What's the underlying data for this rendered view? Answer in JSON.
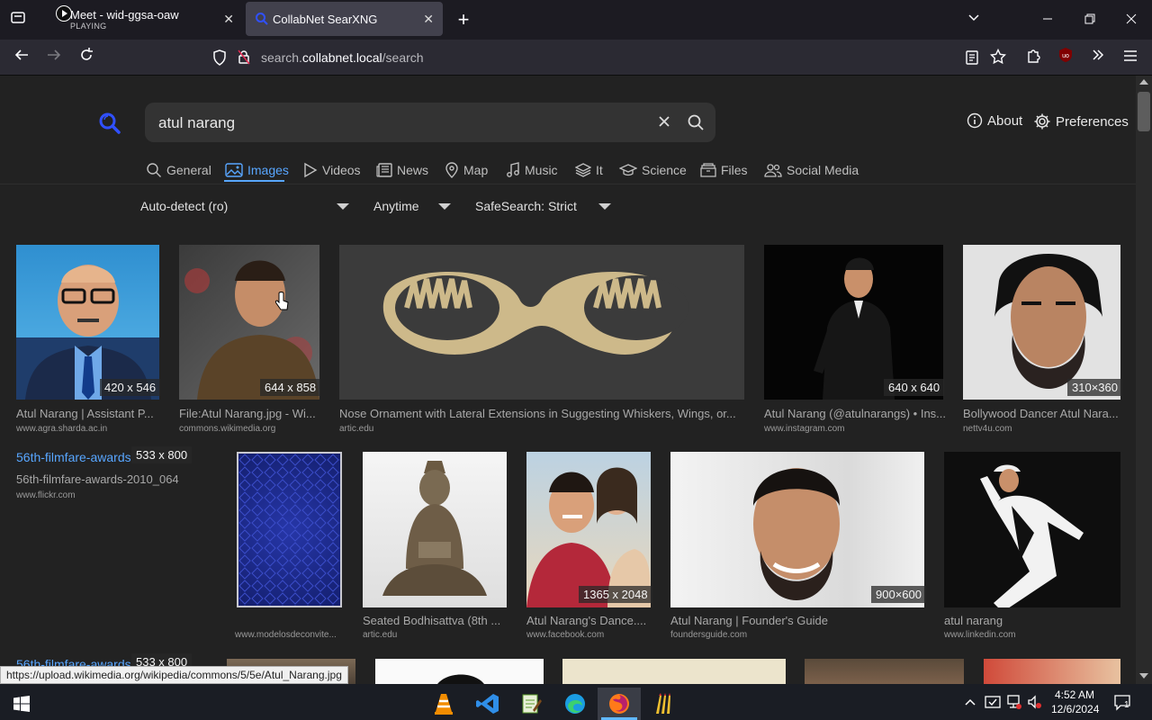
{
  "browser": {
    "tabs": [
      {
        "title": "Meet - wid-ggsa-oaw",
        "subtitle": "PLAYING"
      },
      {
        "title": "CollabNet SearXNG"
      }
    ],
    "url_base": "search.",
    "url_domain": "collabnet.local",
    "url_path": "/search",
    "status_url": "https://upload.wikimedia.org/wikipedia/commons/5/5e/Atul_Narang.jpg"
  },
  "search": {
    "query": "atul narang",
    "about_label": "About",
    "preferences_label": "Preferences"
  },
  "categories": [
    {
      "label": "General"
    },
    {
      "label": "Images"
    },
    {
      "label": "Videos"
    },
    {
      "label": "News"
    },
    {
      "label": "Map"
    },
    {
      "label": "Music"
    },
    {
      "label": "It"
    },
    {
      "label": "Science"
    },
    {
      "label": "Files"
    },
    {
      "label": "Social Media"
    }
  ],
  "filters": {
    "language": "Auto-detect (ro)",
    "time": "Anytime",
    "safesearch": "SafeSearch: Strict"
  },
  "results": [
    {
      "title": "Atul Narang | Assistant P...",
      "url": "www.agra.sharda.ac.in",
      "size": "420 x 546"
    },
    {
      "title": "File:Atul Narang.jpg - Wi...",
      "url": "commons.wikimedia.org",
      "size": "644 x 858"
    },
    {
      "title": "Nose Ornament with Lateral Extensions in Suggesting Whiskers, Wings, or...",
      "url": "artic.edu",
      "size": ""
    },
    {
      "title": "Atul Narang (@atulnarangs) • Ins...",
      "url": "www.instagram.com",
      "size": "640 x 640"
    },
    {
      "title": "Bollywood Dancer Atul Nara...",
      "url": "nettv4u.com",
      "size": "310×360"
    },
    {
      "title": "56th-filmfare-awards-2010_064",
      "link": "56th-filmfare-awards",
      "url": "www.flickr.com",
      "size": "533 x 800"
    },
    {
      "title": "",
      "url": "www.modelosdeconvite...",
      "size": ""
    },
    {
      "title": "Seated Bodhisattva (8th ...",
      "url": "artic.edu",
      "size": ""
    },
    {
      "title": "Atul Narang's Dance....",
      "url": "www.facebook.com",
      "size": "1365 x 2048"
    },
    {
      "title": "Atul Narang | Founder's Guide",
      "url": "foundersguide.com",
      "size": "900×600"
    },
    {
      "title": "atul narang",
      "url": "www.linkedin.com",
      "size": ""
    },
    {
      "title": "",
      "link": "56th-filmfare-awards",
      "url": "",
      "size": "533 x 800"
    }
  ],
  "taskbar": {
    "time": "4:52 AM",
    "date": "12/6/2024",
    "notifications": "1"
  },
  "colors": {
    "accent": "#58a6ff",
    "background": "#222222"
  }
}
